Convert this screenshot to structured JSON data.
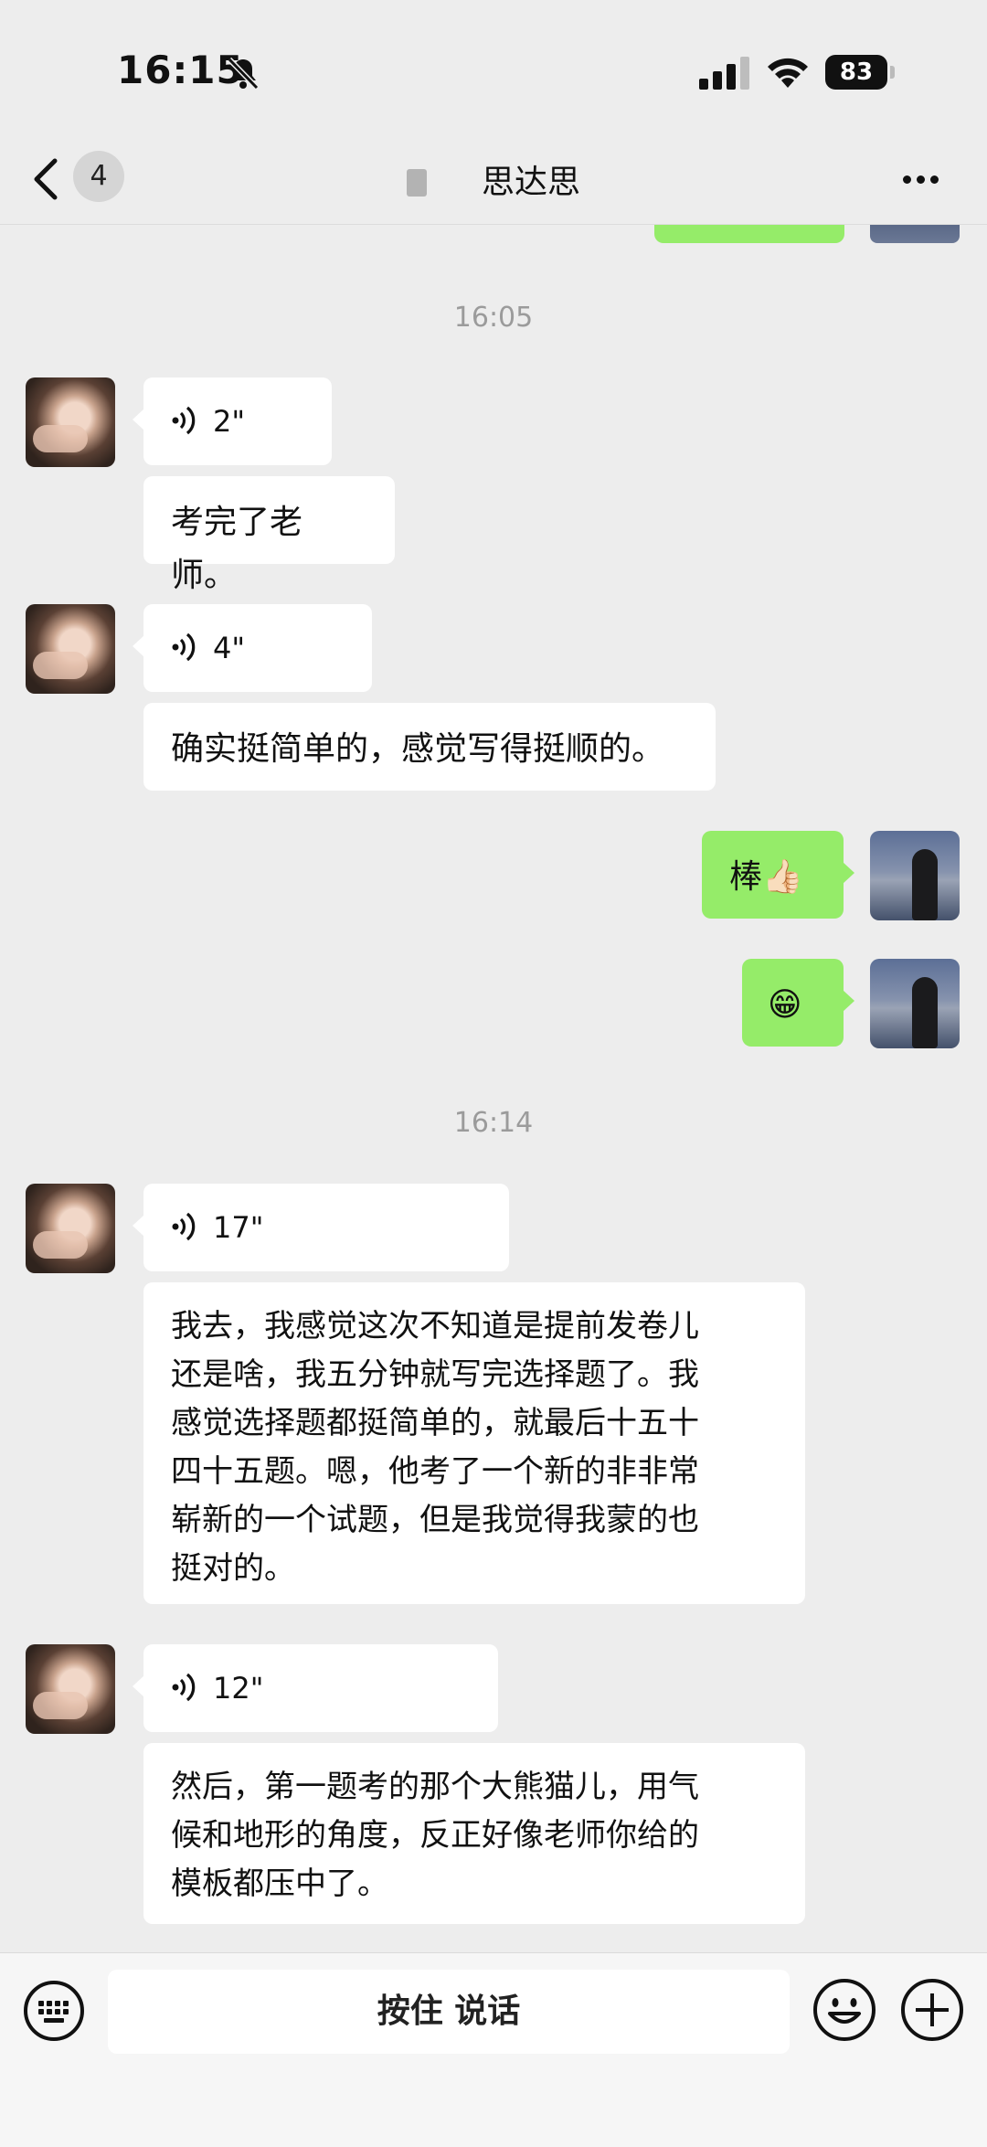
{
  "status_bar": {
    "time": "16:15",
    "battery": "83",
    "icons": [
      "bell-slash-icon",
      "signal-icon",
      "wifi-icon",
      "battery-icon"
    ]
  },
  "nav": {
    "back_badge": "4",
    "title": "思达思",
    "icons": [
      "chevron-left-icon",
      "more-icon"
    ]
  },
  "messages": {
    "ts1": "16:05",
    "m1_voice": "2\"",
    "m2_text": "考完了老师。",
    "m3_voice": "4\"",
    "m4_text": "确实挺简单的，感觉写得挺顺的。",
    "m5_text": "棒👍🏻",
    "m6_text": "😁",
    "ts2": "16:14",
    "m7_voice": "17\"",
    "m8_lines": [
      "我去，我感觉这次不知道是提前发卷儿",
      "还是啥，我五分钟就写完选择题了。我",
      "感觉选择题都挺简单的，就最后十五十",
      "四十五题。嗯，他考了一个新的非非常",
      "崭新的一个试题，但是我觉得我蒙的也",
      "挺对的。"
    ],
    "m9_voice": "12\"",
    "m10_lines": [
      "然后，第一题考的那个大熊猫儿，用气",
      "候和地形的角度，反正好像老师你给的",
      "模板都压中了。"
    ]
  },
  "input_bar": {
    "hold_to_talk": "按住 说话",
    "icons": [
      "keyboard-icon",
      "emoji-icon",
      "plus-icon"
    ]
  },
  "colors": {
    "background": "#ededed",
    "self_bubble": "#95ec69",
    "other_bubble": "#ffffff",
    "timestamp": "#9b9b9b"
  }
}
